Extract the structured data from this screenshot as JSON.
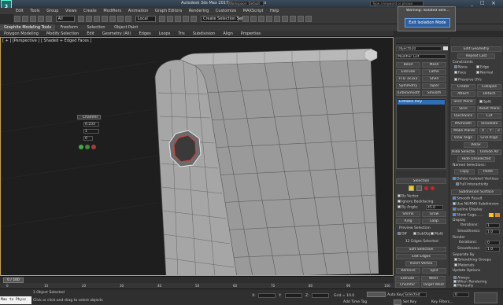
{
  "window": {
    "title": "Autodesk 3ds Max 2017 x64 - Untitled.max",
    "title_short": "Autodesk 3ds Max 2017 x64",
    "workspace": "Workspace: Default",
    "search_placeholder": "Type a keyword or phrase"
  },
  "menu": [
    "Edit",
    "Tools",
    "Group",
    "Views",
    "Create",
    "Modifiers",
    "Animation",
    "Graph Editors",
    "Rendering",
    "Customize",
    "MAXScript",
    "Help"
  ],
  "toolbar": {
    "filter": "All",
    "ref_coord": "Local",
    "named_sel": "Create Selection Set"
  },
  "ribbon": {
    "tabs": [
      "Graphite Modeling Tools",
      "Freeform",
      "Selection",
      "Object Paint"
    ],
    "subtabs": [
      "Polygon Modeling",
      "Modify Selection",
      "Edit",
      "Geometry (All)",
      "Edges",
      "Loops",
      "Tris",
      "Subdivision",
      "Align",
      "Properties"
    ]
  },
  "viewport": {
    "label": "[ + ] [Perspective ] [ Shaded + Edged Faces ]"
  },
  "caddy": {
    "title": "Chamfer",
    "amount": "0.233",
    "segments": "1",
    "option": "0"
  },
  "popup": {
    "title": "Warning: Isolated Sele...",
    "button": "Exit Isolation Mode"
  },
  "command_panel": {
    "object_name": "Object020",
    "modifier_list": "Modifier List",
    "buttons": [
      "Bend",
      "Mesh",
      "Extrude",
      "Lathe",
      "FFD 3x3x3",
      "Shell",
      "Symmetry",
      "Taper",
      "TurboSmooth",
      "Smooth"
    ],
    "stack_item": "Editable Poly",
    "selection_header": "Selection",
    "by_vertex": "By Vertex",
    "ignore_backfacing": "Ignore Backfacing",
    "by_angle": "By Angle:",
    "angle_value": "45.0",
    "shrink": "Shrink",
    "grow": "Grow",
    "ring": "Ring",
    "loop": "Loop",
    "preview_selection": "Preview Selection",
    "preview_opts": [
      "Off",
      "SubObj",
      "Multi"
    ],
    "selected_info": "12 Edges Selected",
    "soft_selection": "Soft Selection",
    "edit_edges": "Edit Edges",
    "insert_vertex": "Insert Vertex",
    "edge_buttons": [
      "Remove",
      "Split",
      "Extrude",
      "Weld",
      "Chamfer",
      "Target Weld",
      "Bridge",
      "Connect"
    ],
    "create_shape": "Create Shape From Selection",
    "weight_label": "Weight:",
    "weight_value": "1.0"
  },
  "right_panel": {
    "edit_geometry": "Edit Geometry",
    "repeat_last": "Repeat Last",
    "constraints": "Constraints",
    "constraint_opts": [
      "None",
      "Edge",
      "Face",
      "Normal"
    ],
    "preserve_uvs": "Preserve UVs",
    "create": "Create",
    "collapse": "Collapse",
    "attach": "Attach",
    "detach": "Detach",
    "slice_plane": "Slice Plane",
    "split": "Split",
    "slice": "Slice",
    "reset_plane": "Reset Plane",
    "quickslice": "QuickSlice",
    "cut": "Cut",
    "msmooth": "MSmooth",
    "tessellate": "Tessellate",
    "make_planar": "Make Planar",
    "xyz": [
      "X",
      "Y",
      "Z"
    ],
    "view_align": "View Align",
    "grid_align": "Grid Align",
    "relax": "Relax",
    "hide_selected": "Hide Selected",
    "unhide_all": "Unhide All",
    "hide_unselected": "Hide Unselected",
    "named_selections": "Named Selections:",
    "copy": "Copy",
    "paste": "Paste",
    "delete_isolated": "Delete Isolated Vertices",
    "full_interactivity": "Full Interactivity",
    "subdivision_surface": "Subdivision Surface",
    "smooth_result": "Smooth Result",
    "use_nurms": "Use NURMS Subdivision",
    "isoline_display": "Isoline Display",
    "show_cage": "Show Cage......",
    "display": "Display",
    "iterations": "Iterations:",
    "iter_value": "1",
    "smoothness": "Smoothness:",
    "smooth_value": "1.0",
    "render": "Render",
    "r_iterations": "Iterations:",
    "r_iter_value": "0",
    "r_smoothness": "Smoothness:",
    "r_smooth_value": "1.0",
    "separate_by": "Separate By",
    "smoothing_groups": "Smoothing Groups",
    "materials": "Materials",
    "update_options": "Update Options",
    "update_opts": [
      "Always",
      "When Rendering",
      "Manually"
    ],
    "cage_colors": [
      "#f5c518",
      "#e08a1e"
    ]
  },
  "timeline": {
    "frame": "0 / 100",
    "ticks": [
      "0",
      "10",
      "20",
      "30",
      "40",
      "50",
      "60",
      "70",
      "80",
      "90",
      "100"
    ]
  },
  "status": {
    "listener": "Max to Physc",
    "line1": "1 Object Selected",
    "line2": "Click or click-and-drag to select objects",
    "x_label": "X:",
    "y_label": "Y:",
    "z_label": "Z:",
    "grid": "Grid = 10.0",
    "add_time_tag": "Add Time Tag",
    "autokey": "Auto Key",
    "selected": "Selected",
    "set_key": "Set Key",
    "key_filters": "Key Filters...",
    "frame_value": "0"
  }
}
